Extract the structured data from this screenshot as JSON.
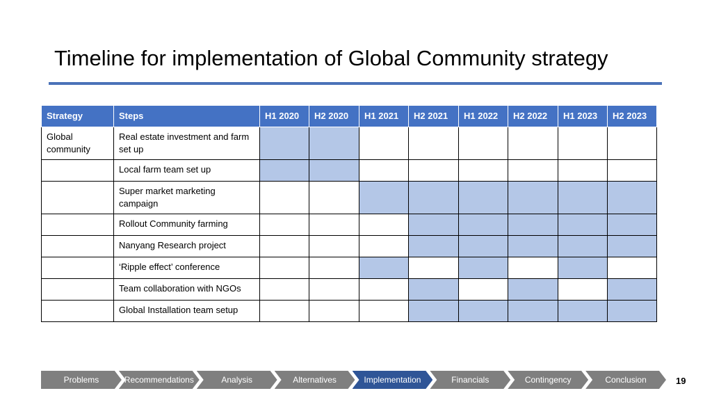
{
  "title": "Timeline for implementation of Global Community strategy",
  "table": {
    "headers": [
      "Strategy",
      "Steps",
      "H1 2020",
      "H2 2020",
      "H1 2021",
      "H2 2021",
      "H1 2022",
      "H2 2022",
      "H1 2023",
      "H2 2023"
    ],
    "rows": [
      {
        "strategy": "Global community",
        "step": "Real estate investment and farm set up",
        "active": [
          true,
          true,
          false,
          false,
          false,
          false,
          false,
          false
        ]
      },
      {
        "strategy": "",
        "step": "Local farm team set up",
        "active": [
          true,
          true,
          false,
          false,
          false,
          false,
          false,
          false
        ]
      },
      {
        "strategy": "",
        "step": "Super market marketing campaign",
        "active": [
          false,
          false,
          true,
          true,
          true,
          true,
          true,
          true
        ]
      },
      {
        "strategy": "",
        "step": "Rollout Community farming",
        "active": [
          false,
          false,
          false,
          true,
          true,
          true,
          true,
          true
        ]
      },
      {
        "strategy": "",
        "step": "Nanyang Research project",
        "active": [
          false,
          false,
          false,
          true,
          true,
          true,
          true,
          true
        ]
      },
      {
        "strategy": "",
        "step": "‘Ripple effect’ conference",
        "active": [
          false,
          false,
          true,
          false,
          true,
          false,
          true,
          false
        ]
      },
      {
        "strategy": "",
        "step": "Team collaboration with NGOs",
        "active": [
          false,
          false,
          false,
          true,
          false,
          true,
          false,
          true
        ]
      },
      {
        "strategy": "",
        "step": "Global Installation team setup",
        "active": [
          false,
          false,
          false,
          true,
          true,
          true,
          true,
          true
        ]
      }
    ]
  },
  "nav": {
    "items": [
      "Problems",
      "Recommendations",
      "Analysis",
      "Alternatives",
      "Implementation",
      "Financials",
      "Contingency",
      "Conclusion"
    ],
    "active": "Implementation"
  },
  "page_number": "19",
  "colors": {
    "header": "#4472c4",
    "filled": "#b4c7e7",
    "nav": "#7f7f7f",
    "nav_active": "#2f5597",
    "rule": "#4a72b8"
  }
}
